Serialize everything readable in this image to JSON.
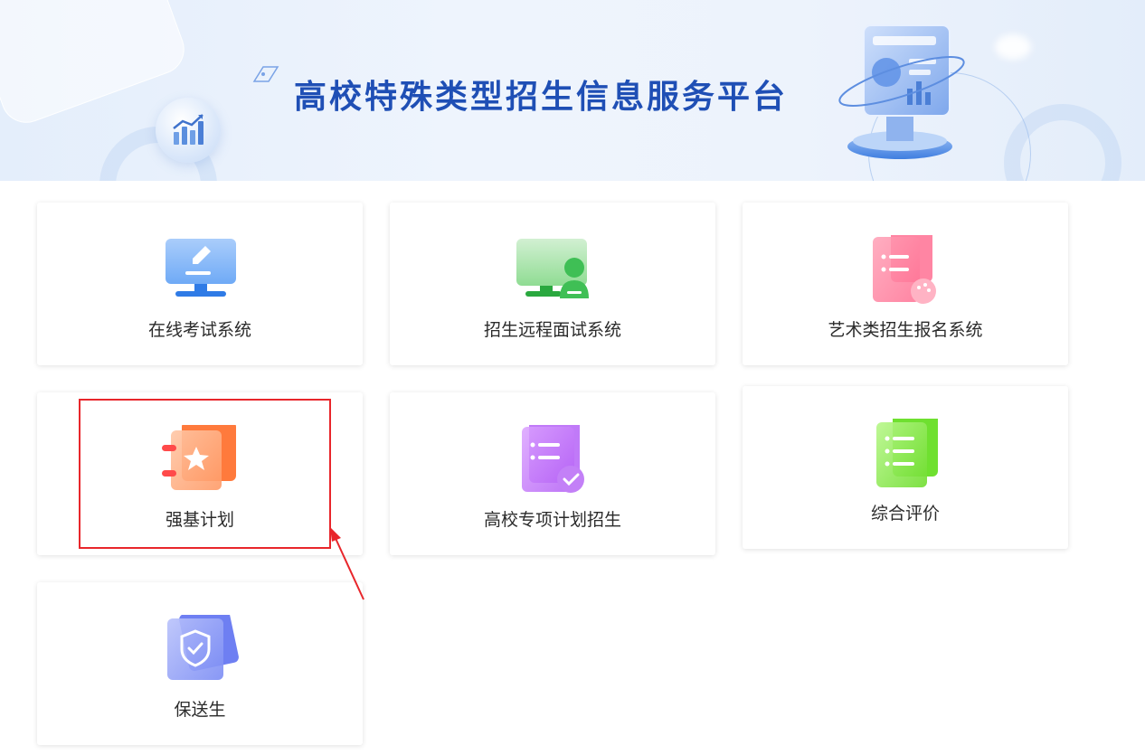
{
  "banner": {
    "title": "高校特殊类型招生信息服务平台"
  },
  "cards": [
    {
      "label": "在线考试系统",
      "icon": "exam-monitor-icon"
    },
    {
      "label": "招生远程面试系统",
      "icon": "remote-interview-icon"
    },
    {
      "label": "艺术类招生报名系统",
      "icon": "art-enrollment-icon"
    },
    {
      "label": "强基计划",
      "icon": "star-book-icon"
    },
    {
      "label": "高校专项计划招生",
      "icon": "checked-list-icon"
    },
    {
      "label": "综合评价",
      "icon": "list-document-icon"
    },
    {
      "label": "保送生",
      "icon": "shield-check-icon"
    }
  ],
  "colors": {
    "title": "#1f4fb5",
    "highlight": "#e8262b"
  }
}
